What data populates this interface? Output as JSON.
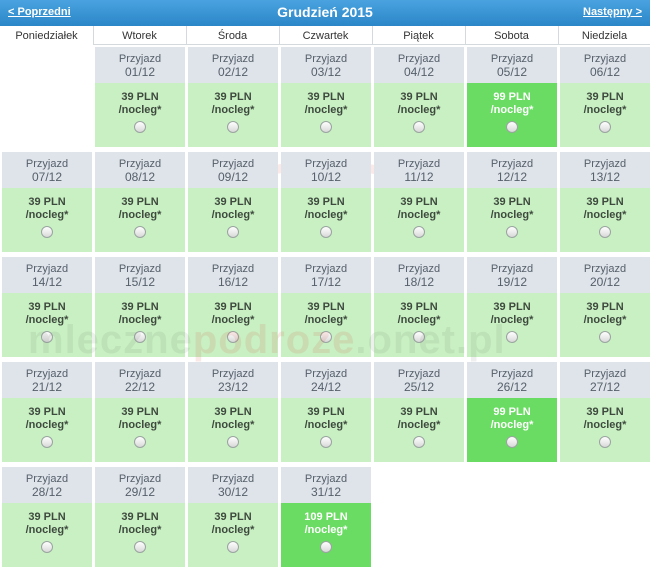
{
  "header": {
    "prev": "< Poprzedni",
    "title": "Grudzień 2015",
    "next": "Następny >"
  },
  "weekdays": [
    "Poniedziałek",
    "Wtorek",
    "Środa",
    "Czwartek",
    "Piątek",
    "Sobota",
    "Niedziela"
  ],
  "arrival_label": "Przyjazd",
  "price_suffix": "/nocleg*",
  "days": [
    {
      "date": "01/12",
      "price": "39 PLN",
      "highlight": false
    },
    {
      "date": "02/12",
      "price": "39 PLN",
      "highlight": false
    },
    {
      "date": "03/12",
      "price": "39 PLN",
      "highlight": false
    },
    {
      "date": "04/12",
      "price": "39 PLN",
      "highlight": false
    },
    {
      "date": "05/12",
      "price": "99 PLN",
      "highlight": true
    },
    {
      "date": "06/12",
      "price": "39 PLN",
      "highlight": false
    },
    {
      "date": "07/12",
      "price": "39 PLN",
      "highlight": false
    },
    {
      "date": "08/12",
      "price": "39 PLN",
      "highlight": false
    },
    {
      "date": "09/12",
      "price": "39 PLN",
      "highlight": false
    },
    {
      "date": "10/12",
      "price": "39 PLN",
      "highlight": false
    },
    {
      "date": "11/12",
      "price": "39 PLN",
      "highlight": false
    },
    {
      "date": "12/12",
      "price": "39 PLN",
      "highlight": false
    },
    {
      "date": "13/12",
      "price": "39 PLN",
      "highlight": false
    },
    {
      "date": "14/12",
      "price": "39 PLN",
      "highlight": false
    },
    {
      "date": "15/12",
      "price": "39 PLN",
      "highlight": false
    },
    {
      "date": "16/12",
      "price": "39 PLN",
      "highlight": false
    },
    {
      "date": "17/12",
      "price": "39 PLN",
      "highlight": false
    },
    {
      "date": "18/12",
      "price": "39 PLN",
      "highlight": false
    },
    {
      "date": "19/12",
      "price": "39 PLN",
      "highlight": false
    },
    {
      "date": "20/12",
      "price": "39 PLN",
      "highlight": false
    },
    {
      "date": "21/12",
      "price": "39 PLN",
      "highlight": false
    },
    {
      "date": "22/12",
      "price": "39 PLN",
      "highlight": false
    },
    {
      "date": "23/12",
      "price": "39 PLN",
      "highlight": false
    },
    {
      "date": "24/12",
      "price": "39 PLN",
      "highlight": false
    },
    {
      "date": "25/12",
      "price": "39 PLN",
      "highlight": false
    },
    {
      "date": "26/12",
      "price": "99 PLN",
      "highlight": true
    },
    {
      "date": "27/12",
      "price": "39 PLN",
      "highlight": false
    },
    {
      "date": "28/12",
      "price": "39 PLN",
      "highlight": false
    },
    {
      "date": "29/12",
      "price": "39 PLN",
      "highlight": false
    },
    {
      "date": "30/12",
      "price": "39 PLN",
      "highlight": false
    },
    {
      "date": "31/12",
      "price": "109 PLN",
      "highlight": true
    }
  ],
  "watermark": "mlecznepodroze.onet.pl",
  "colors": {
    "header": "#2b86c8",
    "date_bg": "#dfe3ea",
    "price_bg": "#c8f0c2",
    "price_bg_highlight": "#6adc63"
  }
}
